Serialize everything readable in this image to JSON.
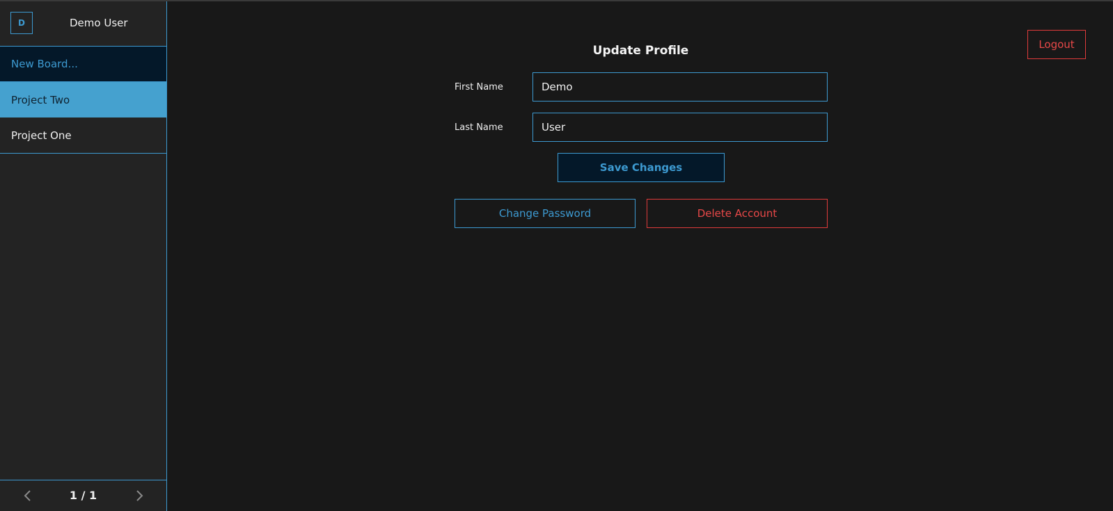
{
  "user": {
    "avatar_initial": "D",
    "name": "Demo User"
  },
  "sidebar": {
    "boards": [
      {
        "label": "New Board...",
        "state": "new"
      },
      {
        "label": "Project Two",
        "state": "selected"
      },
      {
        "label": "Project One",
        "state": "default"
      }
    ],
    "pager": {
      "text": "1 / 1",
      "prev_icon": "chevron-left-icon",
      "next_icon": "chevron-right-icon"
    }
  },
  "header": {
    "logout_label": "Logout"
  },
  "form": {
    "title": "Update Profile",
    "first_name_label": "First Name",
    "first_name_value": "Demo",
    "last_name_label": "Last Name",
    "last_name_value": "User",
    "save_label": "Save Changes",
    "change_password_label": "Change Password",
    "delete_account_label": "Delete Account"
  },
  "colors": {
    "accent": "#3d9ad1",
    "danger": "#e84848",
    "background": "#181818",
    "sidebar": "#232323",
    "selected_board": "#45a1cf"
  }
}
